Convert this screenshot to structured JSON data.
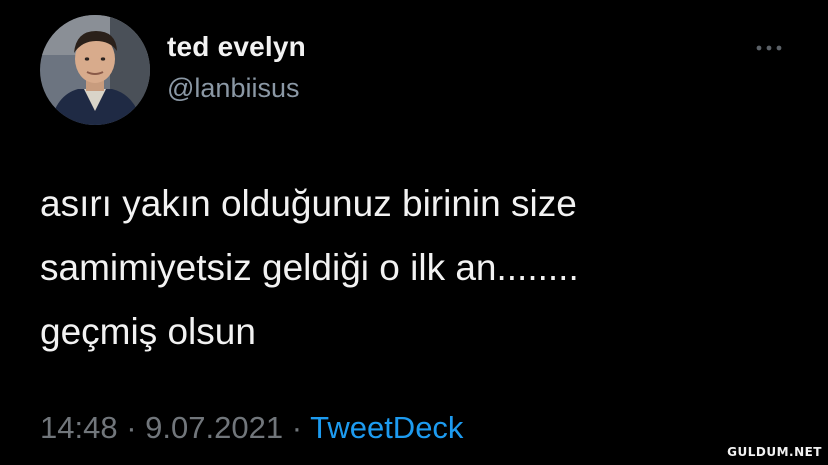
{
  "user": {
    "display_name": "ted evelyn",
    "handle": "@lanbiisus"
  },
  "tweet": {
    "lines": [
      "asırı yakın olduğunuz birinin size",
      "samimiyetsiz geldiği o ilk an........",
      "geçmiş olsun"
    ],
    "time": "14:48",
    "separator": "·",
    "date": "9.07.2021",
    "source": "TweetDeck"
  },
  "icons": {
    "more": "more-options-icon"
  },
  "colors": {
    "background": "#000000",
    "text": "#f2f2f2",
    "secondary": "#8b98a5",
    "meta": "#71767b",
    "link": "#1d9bf0"
  },
  "watermark": "GULDUM.NET"
}
